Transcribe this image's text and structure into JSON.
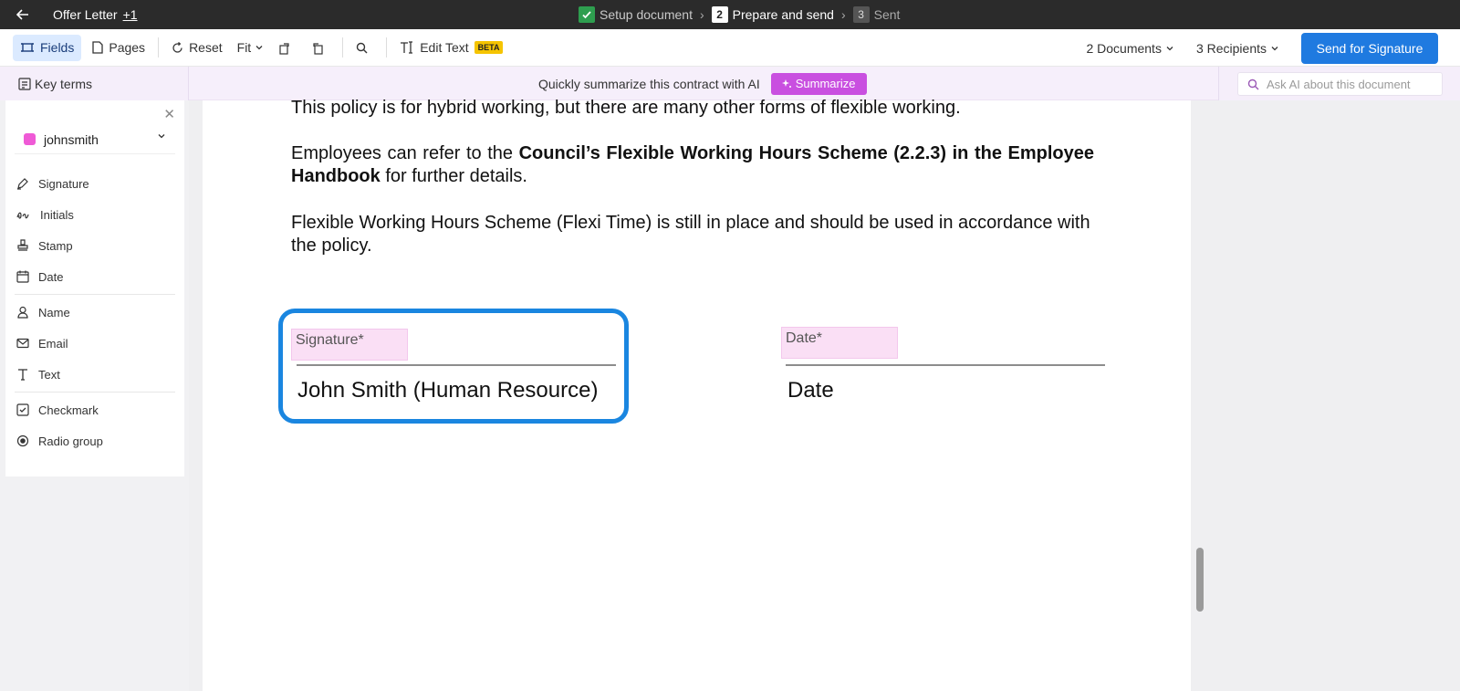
{
  "topbar": {
    "doc_title": "Offer Letter",
    "doc_extra": "+1",
    "steps": [
      {
        "num": "",
        "label": "Setup document"
      },
      {
        "num": "2",
        "label": "Prepare and send"
      },
      {
        "num": "3",
        "label": "Sent"
      }
    ]
  },
  "toolbar": {
    "fields": "Fields",
    "pages": "Pages",
    "reset": "Reset",
    "fit": "Fit",
    "edit_text": "Edit Text",
    "beta": "BETA",
    "documents": "2 Documents",
    "recipients": "3 Recipients",
    "send": "Send for Signature"
  },
  "ai": {
    "key_terms": "Key terms",
    "prompt": "Quickly summarize this contract with AI",
    "summarize": "Summarize",
    "ask_placeholder": "Ask AI about this document"
  },
  "sidebar": {
    "recipient": "johnsmith",
    "swatch_color": "#ef5ad6",
    "fields": [
      {
        "label": "Signature",
        "icon": "pen-icon"
      },
      {
        "label": "Initials",
        "icon": "initials-icon"
      },
      {
        "label": "Stamp",
        "icon": "stamp-icon"
      },
      {
        "label": "Date",
        "icon": "calendar-icon"
      },
      {
        "label": "Name",
        "icon": "person-icon"
      },
      {
        "label": "Email",
        "icon": "mail-icon"
      },
      {
        "label": "Text",
        "icon": "text-icon"
      },
      {
        "label": "Checkmark",
        "icon": "checkbox-icon"
      },
      {
        "label": "Radio group",
        "icon": "radio-icon"
      }
    ]
  },
  "document": {
    "p1": "This policy is for hybrid working, but there are many other forms of flexible working.",
    "p2_pre": "Employees can refer to the ",
    "p2_bold": "Council’s Flexible Working Hours Scheme (2.2.3) in the Employee Handbook",
    "p2_post": " for further details.",
    "p3": "Flexible Working Hours Scheme (Flexi Time) is still in place and should be used in accordance with the policy.",
    "signature_tag": "Signature*",
    "date_tag": "Date*",
    "signer_name": "John Smith (Human Resource)",
    "date_label": "Date"
  }
}
